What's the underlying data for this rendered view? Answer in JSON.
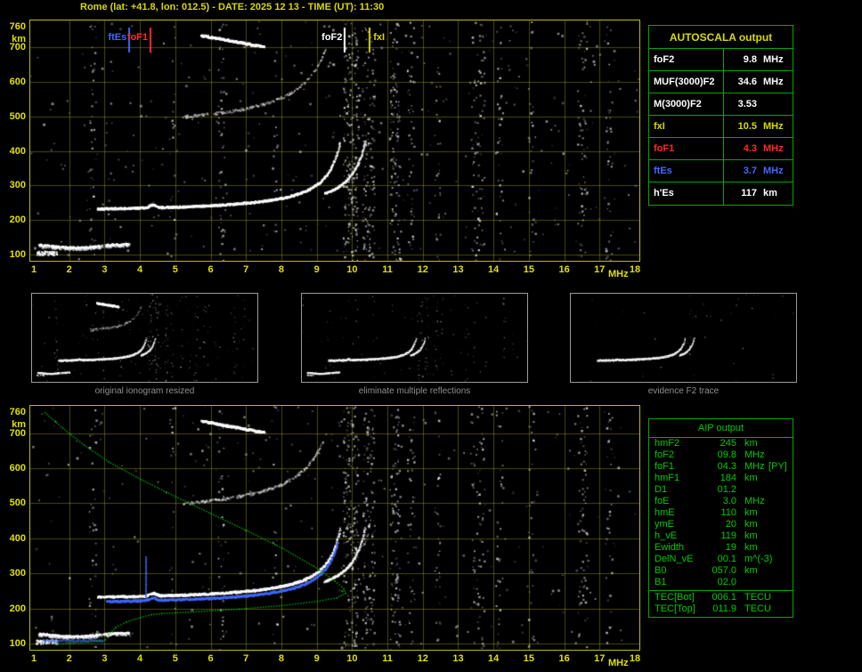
{
  "title": "Rome (lat: +41.8, lon: 012.5) - DATE: 2025 12 13 - TIME (UT): 11:30",
  "colors": {
    "background": "#000000",
    "plot_border": "#bcbc00",
    "grid": "#7a7a28",
    "axis_text": "#e0e000",
    "table_line_green": "#00a800",
    "green_text": "#00cc00",
    "profile_green": "#00bb00",
    "trace_white": "#ffffff",
    "yellow": "#d8d800",
    "red": "#ff2a2a",
    "blue": "#4169ff",
    "caption_gray": "#8f8f8f"
  },
  "autoscala_table": {
    "header": "AUTOSCALA output",
    "rows": [
      {
        "label": "foF2",
        "value": "9.8",
        "unit": "MHz",
        "style": "color:#ffffff"
      },
      {
        "label": "MUF(3000)F2",
        "value": "34.6",
        "unit": "MHz",
        "style": "color:#ffffff"
      },
      {
        "label": "M(3000)F2",
        "value": "3.53",
        "unit": "",
        "style": "color:#ffffff"
      },
      {
        "label": "fxI",
        "value": "10.5",
        "unit": "MHz",
        "style": "color:#d8d800"
      },
      {
        "label": "foF1",
        "value": "4.3",
        "unit": "MHz",
        "style": "color:#ff2a2a"
      },
      {
        "label": "ftEs",
        "value": "3.7",
        "unit": "MHz",
        "style": "color:#4169ff"
      },
      {
        "label": "h'Es",
        "value": "117",
        "unit": "km",
        "style": "color:#ffffff"
      }
    ]
  },
  "aip_table": {
    "header": "AIP output",
    "rows": [
      {
        "label": "hmF2",
        "value": "245",
        "unit": "km",
        "extra": ""
      },
      {
        "label": "foF2",
        "value": "09.8",
        "unit": "MHz",
        "extra": ""
      },
      {
        "label": "foF1",
        "value": "04.3",
        "unit": "MHz",
        "extra": "[PY]"
      },
      {
        "label": "hmF1",
        "value": "184",
        "unit": "km",
        "extra": ""
      },
      {
        "label": "D1",
        "value": "01.2",
        "unit": "",
        "extra": ""
      },
      {
        "label": "foE",
        "value": "3.0",
        "unit": "MHz",
        "extra": ""
      },
      {
        "label": "hmE",
        "value": "110",
        "unit": "km",
        "extra": ""
      },
      {
        "label": "ymE",
        "value": "20",
        "unit": "km",
        "extra": ""
      },
      {
        "label": "h_vE",
        "value": "119",
        "unit": "km",
        "extra": ""
      },
      {
        "label": "Ewidth",
        "value": "19",
        "unit": "km",
        "extra": ""
      },
      {
        "label": "DelN_vE",
        "value": "00.1",
        "unit": "m^(-3)",
        "extra": ""
      },
      {
        "label": "B0",
        "value": "057.0",
        "unit": "km",
        "extra": ""
      },
      {
        "label": "B1",
        "value": "02.0",
        "unit": "",
        "extra": ""
      },
      {
        "label": "TEC[Bot]",
        "value": "006.1",
        "unit": "TECU",
        "extra": ""
      },
      {
        "label": "TEC[Top]",
        "value": "011.9",
        "unit": "TECU",
        "extra": ""
      }
    ]
  },
  "thumbnails": [
    {
      "caption": "original ionogram resized"
    },
    {
      "caption": "eliminate multiple reflections"
    },
    {
      "caption": "evidence F2 trace"
    }
  ],
  "ionogram": {
    "x_axis": {
      "label": "MHz",
      "min": 1,
      "max": 18,
      "ticks": [
        1,
        2,
        3,
        4,
        5,
        6,
        7,
        8,
        9,
        10,
        11,
        12,
        13,
        14,
        15,
        16,
        17,
        18
      ]
    },
    "y_axis": {
      "label": "km",
      "min": 100,
      "max": 760,
      "ticks": [
        760,
        700,
        600,
        500,
        400,
        300,
        200,
        100
      ]
    },
    "markers": [
      {
        "name": "ftEs",
        "freq": 3.7,
        "color": "#4169ff"
      },
      {
        "name": "foF1",
        "freq": 4.3,
        "color": "#ff2a2a"
      },
      {
        "name": "foF2",
        "freq": 9.8,
        "color": "#ffffff"
      },
      {
        "name": "fxI",
        "freq": 10.5,
        "color": "#d8d800"
      }
    ],
    "parameters": {
      "foF2_MHz": 9.8,
      "fxI_MHz": 10.5,
      "foF1_MHz": 4.3,
      "ftEs_MHz": 3.7,
      "hEs_km": 117,
      "hmF2_km": 245,
      "hmF1_km": 184,
      "hmE_km": 110,
      "foE_MHz": 3.0
    }
  }
}
